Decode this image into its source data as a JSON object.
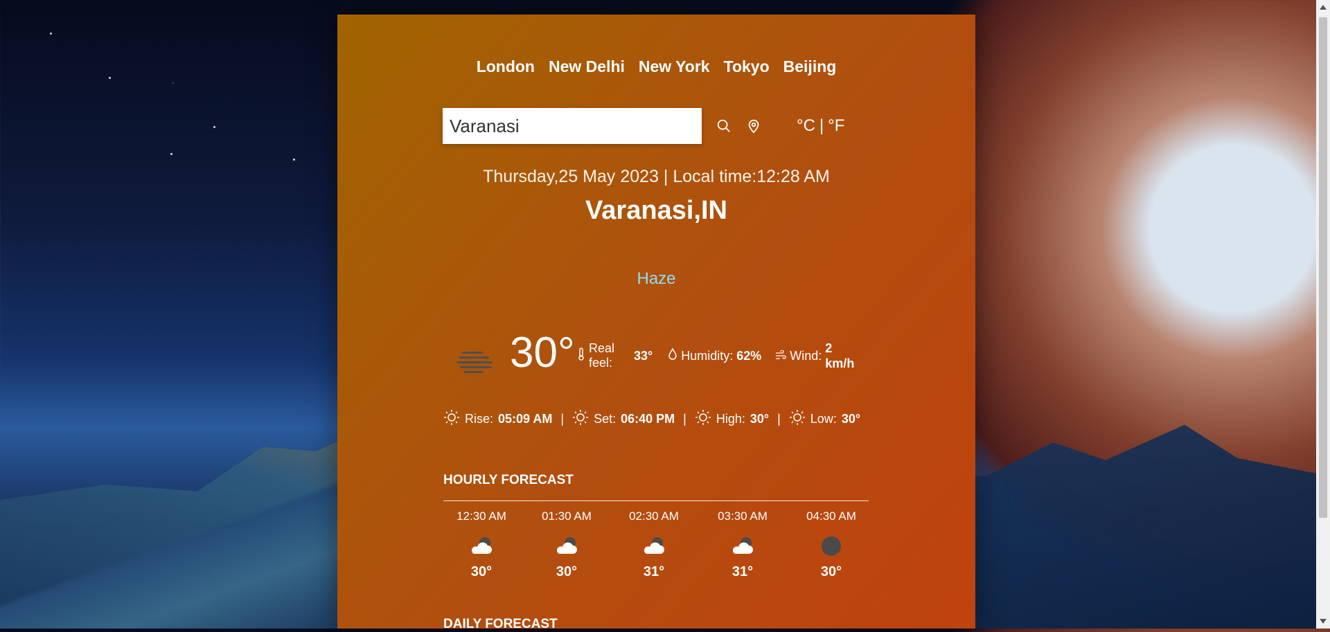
{
  "cities": [
    "London",
    "New Delhi",
    "New York",
    "Tokyo",
    "Beijing"
  ],
  "search": {
    "value": "Varanasi"
  },
  "units": {
    "celsius": "°C",
    "separator": "|",
    "fahrenheit": "°F"
  },
  "datetime": "Thursday,25 May 2023 | Local time:12:28 AM",
  "location": "Varanasi,IN",
  "condition": "Haze",
  "current": {
    "temp": "30°",
    "real_feel_label": "Real feel:",
    "real_feel_value": "33°",
    "humidity_label": "Humidity:",
    "humidity_value": "62%",
    "wind_label": "Wind:",
    "wind_value": "2 km/h"
  },
  "sun": {
    "rise_label": "Rise:",
    "rise_value": "05:09 AM",
    "set_label": "Set:",
    "set_value": "06:40 PM",
    "high_label": "High:",
    "high_value": "30°",
    "low_label": "Low:",
    "low_value": "30°",
    "separator": "|"
  },
  "hourly_title": "HOURLY FORECAST",
  "hourly": [
    {
      "time": "12:30 AM",
      "temp": "30°",
      "icon": "cloud-night-icon"
    },
    {
      "time": "01:30 AM",
      "temp": "30°",
      "icon": "cloud-night-icon"
    },
    {
      "time": "02:30 AM",
      "temp": "31°",
      "icon": "cloud-night-icon"
    },
    {
      "time": "03:30 AM",
      "temp": "31°",
      "icon": "cloud-night-icon"
    },
    {
      "time": "04:30 AM",
      "temp": "30°",
      "icon": "moon-icon"
    }
  ],
  "daily_title": "DAILY FORECAST",
  "colors": {
    "panel_start": "#a06400",
    "panel_end": "#c0420d",
    "condition": "#8fdff5"
  }
}
